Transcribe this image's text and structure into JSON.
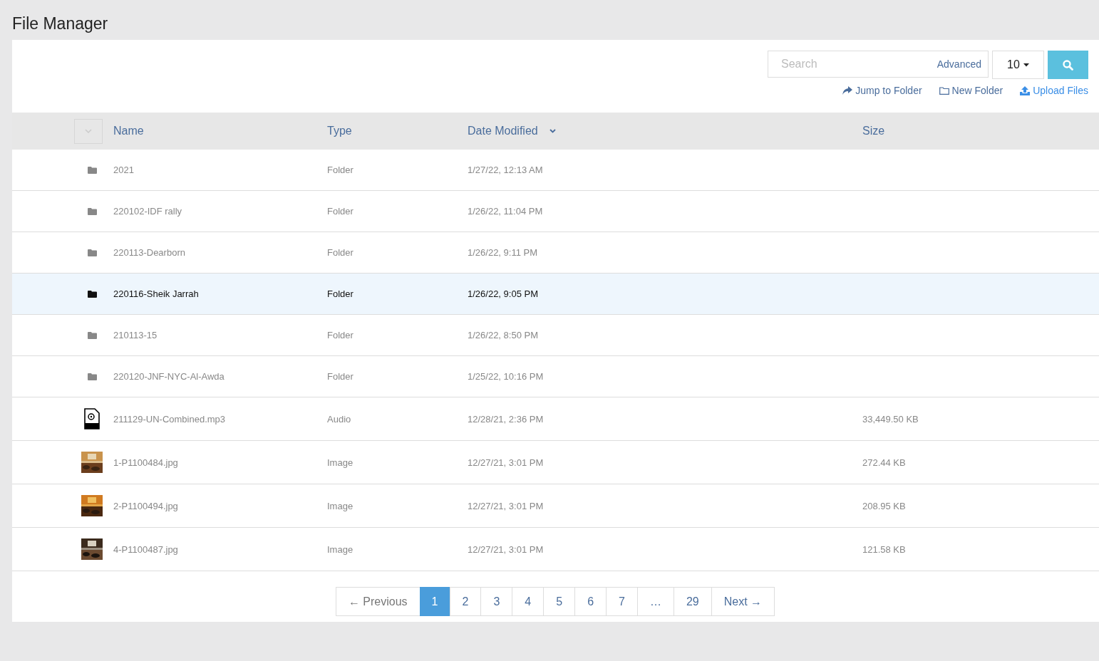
{
  "page_title": "File Manager",
  "toolbar": {
    "search": {
      "placeholder": "Search"
    },
    "advanced_link": "Advanced",
    "page_size": "10",
    "actions": [
      {
        "kind": "jump",
        "label": "Jump to Folder"
      },
      {
        "kind": "folder",
        "label": "New Folder"
      },
      {
        "kind": "upload",
        "label": "Upload Files"
      }
    ]
  },
  "table": {
    "columns": [
      {
        "label": "Name",
        "sorted": false
      },
      {
        "label": "Type",
        "sorted": false
      },
      {
        "label": "Date Modified",
        "sorted": true
      },
      {
        "label": "Size",
        "sorted": false
      }
    ],
    "rows": [
      {
        "kind": "folder",
        "name": "2021",
        "type": "Folder",
        "date": "1/27/22, 12:13 AM",
        "selected": false
      },
      {
        "kind": "folder",
        "name": "220102-IDF rally",
        "type": "Folder",
        "date": "1/26/22, 11:04 PM",
        "selected": false
      },
      {
        "kind": "folder",
        "name": "220113-Dearborn",
        "type": "Folder",
        "date": "1/26/22, 9:11 PM",
        "selected": false
      },
      {
        "kind": "folder",
        "name": "220116-Sheik Jarrah",
        "type": "Folder",
        "date": "1/26/22, 9:05 PM",
        "selected": true
      },
      {
        "kind": "folder",
        "name": "210113-15",
        "type": "Folder",
        "date": "1/26/22, 8:50 PM",
        "selected": false
      },
      {
        "kind": "folder",
        "name": "220120-JNF-NYC-Al-Awda",
        "type": "Folder",
        "date": "1/25/22, 10:16 PM",
        "selected": false
      },
      {
        "kind": "audio",
        "name": "211129-UN-Combined.mp3",
        "type": "Audio",
        "date": "12/28/21, 2:36 PM",
        "size": "33,449.50 KB",
        "selected": false
      },
      {
        "kind": "picture",
        "name": "1-P1100484.jpg",
        "type": "Image",
        "date": "12/27/21, 3:01 PM",
        "size": "272.44 KB",
        "selected": false
      },
      {
        "kind": "picture",
        "name": "2-P1100494.jpg",
        "type": "Image",
        "date": "12/27/21, 3:01 PM",
        "size": "208.95 KB",
        "selected": false
      },
      {
        "kind": "picture",
        "name": "4-P1100487.jpg",
        "type": "Image",
        "date": "12/27/21, 3:01 PM",
        "size": "121.58 KB",
        "selected": false
      }
    ]
  },
  "pagination": {
    "previous": {
      "label": "← Previous",
      "disabled": true
    },
    "pages": [
      {
        "label": "1",
        "selected": true
      },
      {
        "label": "2",
        "selected": false
      },
      {
        "label": "3",
        "selected": false
      },
      {
        "label": "4",
        "selected": false
      },
      {
        "label": "5",
        "selected": false
      },
      {
        "label": "6",
        "selected": false
      },
      {
        "label": "7",
        "selected": false
      },
      {
        "label": "…",
        "selected": false
      },
      {
        "label": "29",
        "selected": false
      }
    ],
    "next": {
      "label": "Next →",
      "disabled": false
    }
  }
}
